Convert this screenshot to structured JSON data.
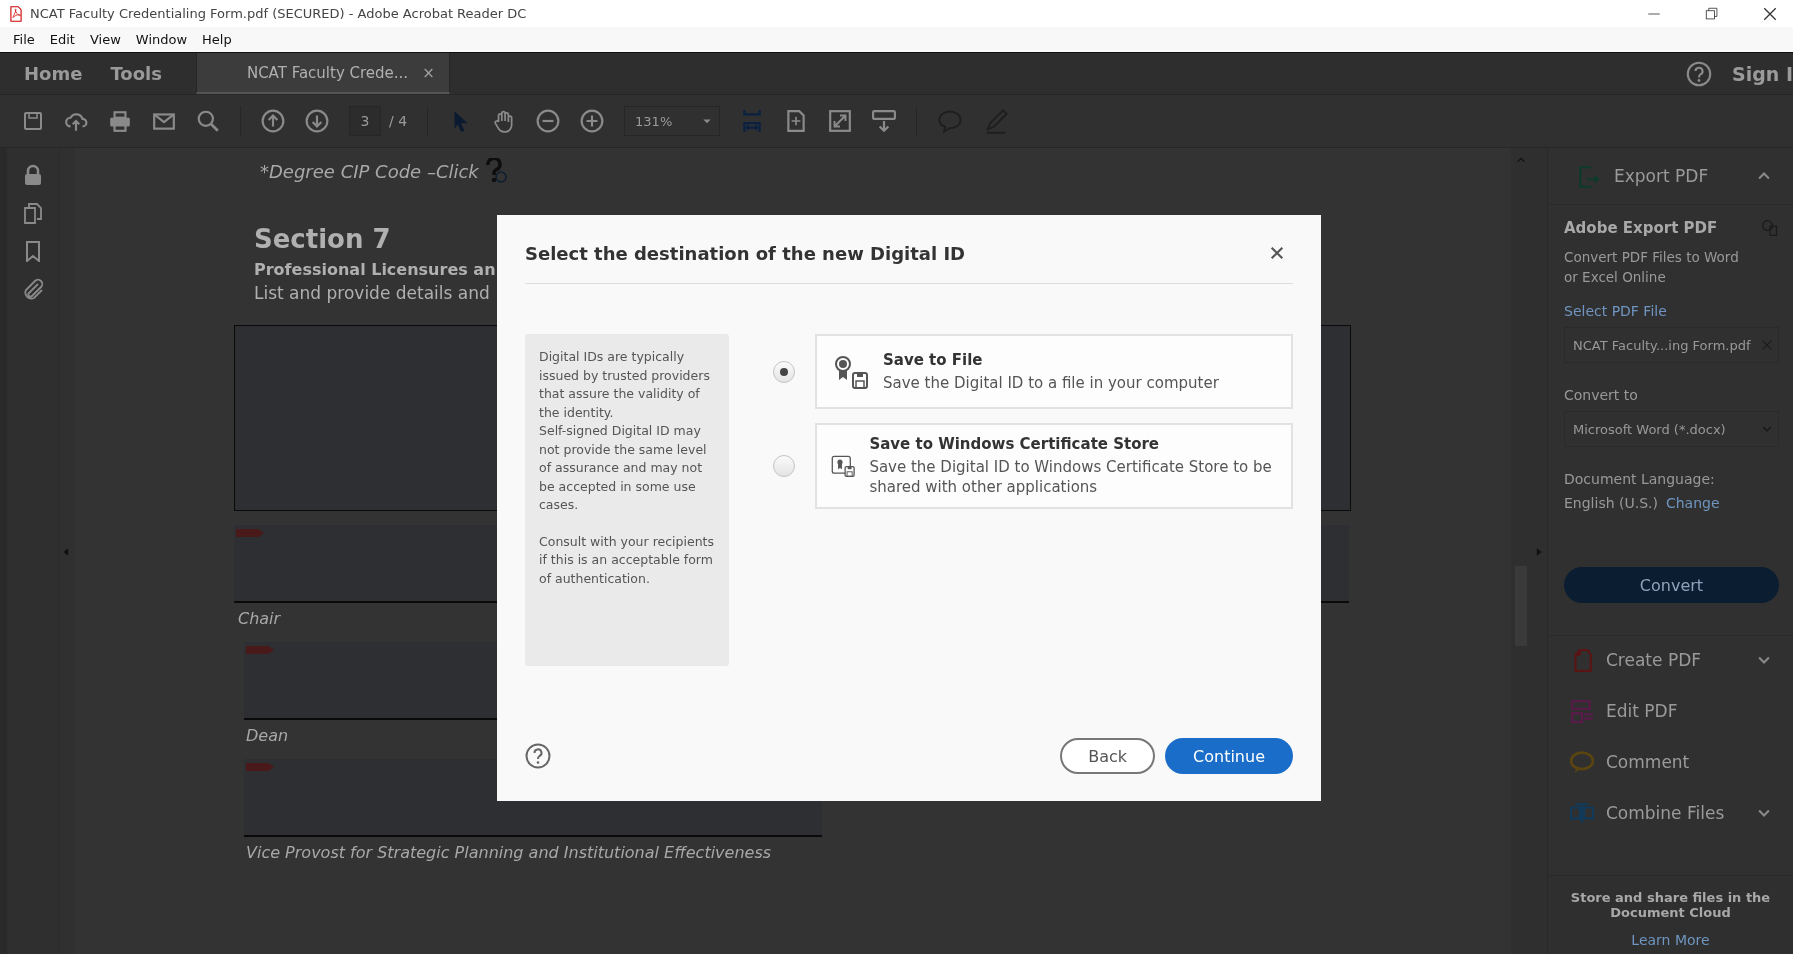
{
  "window": {
    "title": "NCAT Faculty Credentialing Form.pdf (SECURED) - Adobe Acrobat Reader DC"
  },
  "menu": [
    "File",
    "Edit",
    "View",
    "Window",
    "Help"
  ],
  "tabs": [
    {
      "label": "Home",
      "selected": false,
      "kind": "nav"
    },
    {
      "label": "Tools",
      "selected": false,
      "kind": "nav"
    },
    {
      "label": "NCAT Faculty Crede...",
      "selected": true,
      "kind": "document",
      "close": "×"
    }
  ],
  "header_right": {
    "sign_in": "Sign I"
  },
  "toolbar": {
    "page_current": "3",
    "page_total": "/ 4",
    "zoom": "131%"
  },
  "document": {
    "cip_line": "*Degree CIP Code –Click",
    "section_title": "Section 7",
    "subtitle": "Professional Licensures an",
    "intro": "List and provide details and",
    "signatures": [
      {
        "label": "Chair"
      },
      {
        "label": "Dean"
      },
      {
        "label": "Vice Provost for Strategic Planning and Institutional Effectiveness"
      }
    ]
  },
  "right_panel": {
    "export_title": "Export PDF",
    "heading": "Adobe Export PDF",
    "description": "Convert PDF Files to Word or Excel Online",
    "select_label": "Select PDF File",
    "file_name": "NCAT Faculty...ing Form.pdf",
    "convert_to_label": "Convert to",
    "format": "Microsoft Word (*.docx)",
    "language_label": "Document Language:",
    "language": "English (U.S.)",
    "change_link": "Change",
    "convert_button": "Convert",
    "tools": [
      {
        "label": "Create PDF",
        "kind": "create",
        "color": "#5a1414",
        "expandable": true
      },
      {
        "label": "Edit PDF",
        "kind": "edit",
        "color": "#5a1a4a",
        "expandable": false
      },
      {
        "label": "Comment",
        "kind": "comment",
        "color": "#5a4510",
        "expandable": false
      },
      {
        "label": "Combine Files",
        "kind": "combine",
        "color": "#123a5a",
        "expandable": true
      }
    ],
    "cloud_text": "Store and share files in the Document Cloud",
    "learn_more": "Learn More"
  },
  "dialog": {
    "title": "Select the destination of the new Digital ID",
    "info": [
      [
        "Digital IDs are typically issued by trusted providers that assure the validity of the identity.",
        "Self-signed Digital ID may not provide the same level of assurance and may not be accepted in some use cases."
      ],
      [
        "Consult with your recipients if this is an acceptable form of authentication."
      ]
    ],
    "options": [
      {
        "title": "Save to File",
        "description": "Save the Digital ID to a file in your computer",
        "selected": true
      },
      {
        "title": "Save to Windows Certificate Store",
        "description": "Save the Digital ID to Windows Certificate Store to be shared with other applications",
        "selected": false
      }
    ],
    "buttons": [
      {
        "label": "Back",
        "kind": "secondary"
      },
      {
        "label": "Continue",
        "kind": "primary"
      }
    ]
  }
}
